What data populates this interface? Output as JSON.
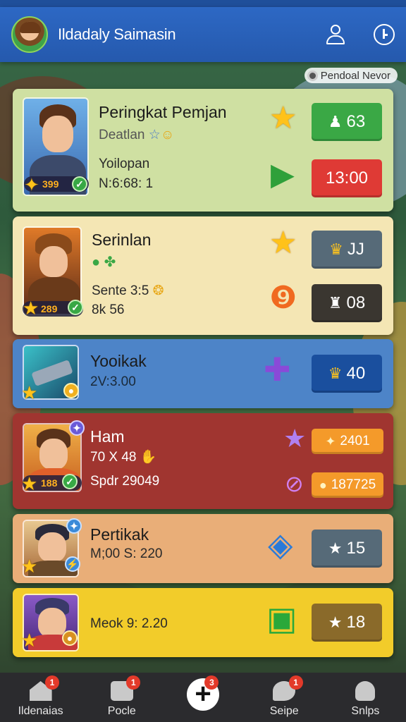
{
  "app": {
    "title": "Ildadaly Saimasin"
  },
  "topbar_pill": "Pendoal Nevor",
  "cards": [
    {
      "title": "Peringkat Pemjan",
      "subtitle": "Deatlan",
      "line2": "Yoilopan",
      "line3": "N:6:68: 1",
      "level": "399",
      "btn_top": "63",
      "btn_bottom": "13:00",
      "colors": {
        "bg": "#cfe0a2",
        "btn_top": "#3aa845",
        "btn_bottom": "#df3a35"
      }
    },
    {
      "title": "Serinlan",
      "line2": "Sente 3:5",
      "line3": "8k 56",
      "level": "289",
      "btn_top": "JJ",
      "btn_bottom": "08",
      "colors": {
        "bg": "#f4e6b4",
        "btn_top": "#566a78",
        "btn_bottom": "#3a3630"
      }
    },
    {
      "title": "Yooikak",
      "line2": "2V:3.00",
      "btn_top": "40",
      "colors": {
        "bg": "#4d84c8",
        "btn_top": "#1a4f9e"
      }
    },
    {
      "title": "Ham",
      "line2": "70 X 48",
      "line3": "Spdr 29049",
      "level": "188",
      "btn_top": "2401",
      "btn_bottom": "187725",
      "colors": {
        "bg": "#a03530",
        "btn_top": "#f49a2a",
        "btn_bottom": "#f49a2a"
      }
    },
    {
      "title": "Pertikak",
      "line2": "M;00 S: 220",
      "btn_top": "15",
      "colors": {
        "bg": "#e9ae78",
        "btn_top": "#566a78"
      }
    },
    {
      "title": "",
      "line2": "Meok 9: 2.20",
      "btn_top": "18",
      "colors": {
        "bg": "#f2cc2a",
        "btn_top": "#8a6a2a"
      }
    }
  ],
  "nav": [
    {
      "label": "Ildenaias",
      "badge": "1"
    },
    {
      "label": "Pocle",
      "badge": "1"
    },
    {
      "label": "",
      "badge": "3"
    },
    {
      "label": "Seipe",
      "badge": "1"
    },
    {
      "label": "Snlps",
      "badge": ""
    }
  ]
}
